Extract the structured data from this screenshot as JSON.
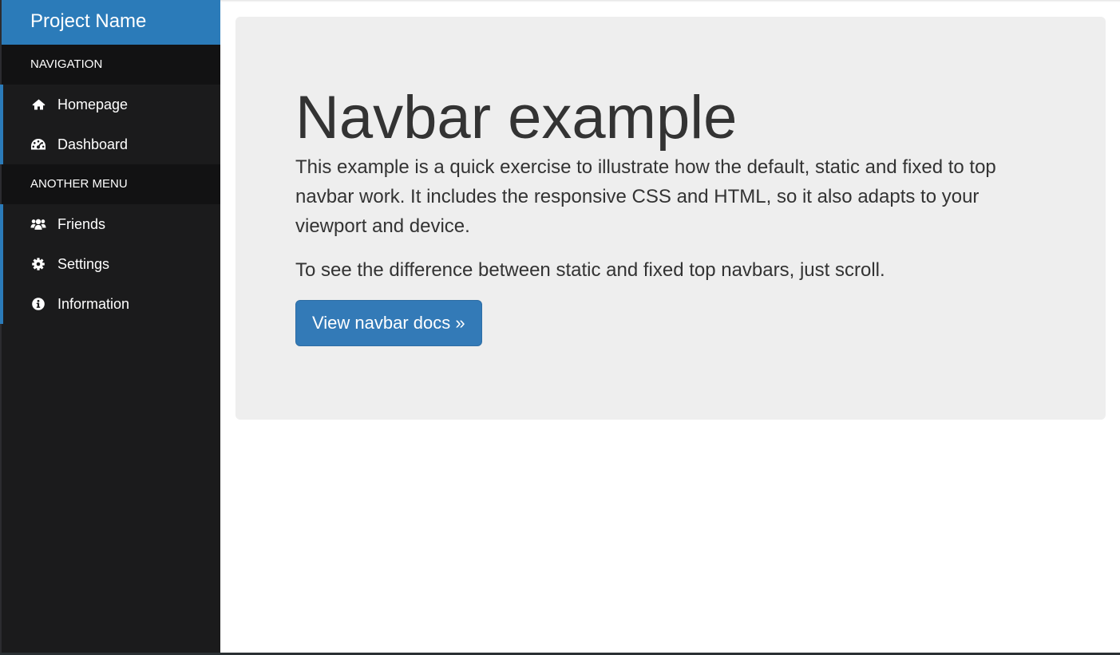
{
  "brand": {
    "title": "Project Name"
  },
  "sidebar": {
    "sections": [
      {
        "header": "NAVIGATION",
        "items": [
          {
            "label": "Homepage",
            "icon": "home-icon"
          },
          {
            "label": "Dashboard",
            "icon": "dashboard-icon"
          }
        ]
      },
      {
        "header": "ANOTHER MENU",
        "items": [
          {
            "label": "Friends",
            "icon": "users-icon"
          },
          {
            "label": "Settings",
            "icon": "gear-icon"
          },
          {
            "label": "Information",
            "icon": "info-icon"
          }
        ]
      }
    ]
  },
  "main": {
    "heading": "Navbar example",
    "paragraph1": "This example is a quick exercise to illustrate how the default, static and fixed to top navbar work. It includes the responsive CSS and HTML, so it also adapts to your viewport and device.",
    "paragraph2": "To see the difference between static and fixed top navbars, just scroll.",
    "button_label": "View navbar docs »"
  },
  "colors": {
    "accent": "#2b7bb9",
    "sidebar_bg": "#1b1b1c",
    "section_header_bg": "#121213",
    "jumbotron_bg": "#eeeeee",
    "button_bg": "#337ab7"
  }
}
